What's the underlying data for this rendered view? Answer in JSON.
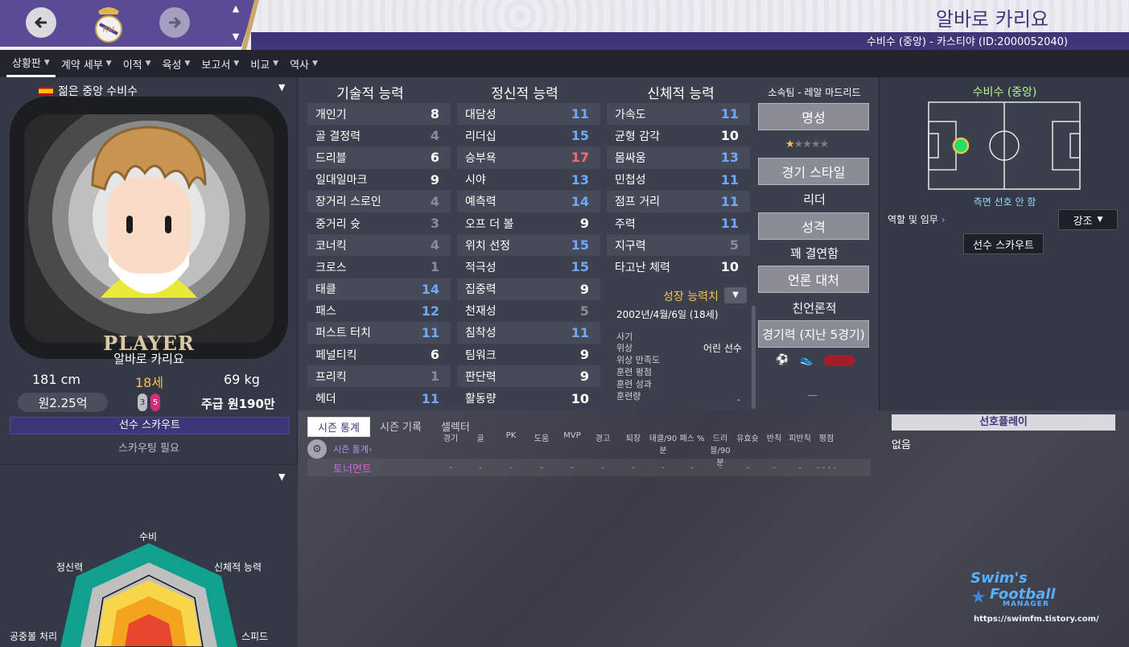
{
  "header": {
    "player_name": "알바로 카리요",
    "subtitle": "수비수 (중앙) - 카스티야 (ID:2000052040)"
  },
  "menu": [
    {
      "label": "상황판"
    },
    {
      "label": "계약 세부"
    },
    {
      "label": "이적"
    },
    {
      "label": "육성"
    },
    {
      "label": "보고서"
    },
    {
      "label": "비교"
    },
    {
      "label": "역사"
    }
  ],
  "profile": {
    "title": "젊은 중앙 수비수",
    "portrait_label": "PLAYER",
    "name": "알바로 카리요",
    "height": "181 cm",
    "age": "18세",
    "weight": "69 kg",
    "value": "원2.25억",
    "foot_left": "3",
    "foot_right": "5",
    "wage": "주급 원190만",
    "scout_button": "선수 스카우트",
    "scout_status": "스카우팅 필요"
  },
  "radar": {
    "labels": {
      "defense": "수비",
      "physical": "신체적 능력",
      "speed": "스피드",
      "aerial": "공중볼 처리",
      "mental": "정신력"
    }
  },
  "attributes": {
    "technical_title": "기술적 능력",
    "mental_title": "정신적 능력",
    "physical_title": "신체적 능력",
    "technical": [
      {
        "name": "개인기",
        "value": "8"
      },
      {
        "name": "골 결정력",
        "value": "4"
      },
      {
        "name": "드리블",
        "value": "6"
      },
      {
        "name": "일대일마크",
        "value": "9"
      },
      {
        "name": "장거리 스로인",
        "value": "4"
      },
      {
        "name": "중거리 슛",
        "value": "3"
      },
      {
        "name": "코너킥",
        "value": "4"
      },
      {
        "name": "크로스",
        "value": "1"
      },
      {
        "name": "태클",
        "value": "14"
      },
      {
        "name": "패스",
        "value": "12"
      },
      {
        "name": "퍼스트 터치",
        "value": "11"
      },
      {
        "name": "페널티킥",
        "value": "6"
      },
      {
        "name": "프리킥",
        "value": "1"
      },
      {
        "name": "헤더",
        "value": "11"
      }
    ],
    "mental": [
      {
        "name": "대담성",
        "value": "11"
      },
      {
        "name": "리더십",
        "value": "15"
      },
      {
        "name": "승부욕",
        "value": "17"
      },
      {
        "name": "시야",
        "value": "13"
      },
      {
        "name": "예측력",
        "value": "14"
      },
      {
        "name": "오프 더 볼",
        "value": "9"
      },
      {
        "name": "위치 선정",
        "value": "15"
      },
      {
        "name": "적극성",
        "value": "15"
      },
      {
        "name": "집중력",
        "value": "9"
      },
      {
        "name": "천재성",
        "value": "5"
      },
      {
        "name": "침착성",
        "value": "11"
      },
      {
        "name": "팀워크",
        "value": "9"
      },
      {
        "name": "판단력",
        "value": "9"
      },
      {
        "name": "활동량",
        "value": "10"
      }
    ],
    "physical": [
      {
        "name": "가속도",
        "value": "11"
      },
      {
        "name": "균형 감각",
        "value": "10"
      },
      {
        "name": "몸싸움",
        "value": "13"
      },
      {
        "name": "민첩성",
        "value": "11"
      },
      {
        "name": "점프 거리",
        "value": "11"
      },
      {
        "name": "주력",
        "value": "11"
      },
      {
        "name": "지구력",
        "value": "5"
      },
      {
        "name": "타고난 체력",
        "value": "10"
      }
    ]
  },
  "growth": {
    "title": "성장 능력치",
    "date": "2002년/4월/6일 (18세)",
    "lines": [
      "사기",
      "위상",
      "위상 만족도",
      "훈련 평점",
      "훈련 성과",
      "훈련량"
    ],
    "status": "어린 선수",
    "dash": "-"
  },
  "club": {
    "team": "소속팀 - 레알 마드리드",
    "reputation_button": "명성",
    "style_button": "경기 스타일",
    "style_value": "리더",
    "personality_button": "성격",
    "personality_value": "꽤 결연함",
    "media_button": "언론 대처",
    "media_value": "친언론적",
    "form_button": "경기력 (지난 5경기)",
    "form_dash": "—"
  },
  "position": {
    "title": "수비수 (중앙)",
    "side": "측면 선호 안 함",
    "role_label": "역할 및 임무",
    "emphasis_button": "강조",
    "scout_button": "선수 스카우트"
  },
  "bottom": {
    "tabs": [
      {
        "label": "시즌 통계"
      },
      {
        "label": "시즌 기록"
      },
      {
        "label": "셀렉터"
      }
    ],
    "season_link": "시즌 통계",
    "headers": [
      "경기",
      "골",
      "PK",
      "도움",
      "MVP",
      "경고",
      "퇴장",
      "태클/90분",
      "패스 %",
      "드리블/90분",
      "유효슛",
      "반칙",
      "피반칙",
      "평점"
    ],
    "row_name": "토너먼트",
    "row_values": [
      "-",
      "-",
      "-",
      "-",
      "-",
      "-",
      "-",
      "-",
      "-",
      "-",
      "-",
      "-",
      "-",
      "- - - -"
    ],
    "pref_title": "선호플레이",
    "pref_value": "없음",
    "watermark": {
      "line1": "Swim's",
      "line2": "Football",
      "line3": "MANAGER",
      "url": "https://swimfm.tistory.com/"
    }
  },
  "colors": {
    "brand_purple": "#3e3676",
    "header_purple": "#5a4b96",
    "gold": "#f4c34a",
    "attr_high": "#6fa8ff",
    "attr_top": "#ff6b6b",
    "attr_low": "#8a8c96"
  }
}
